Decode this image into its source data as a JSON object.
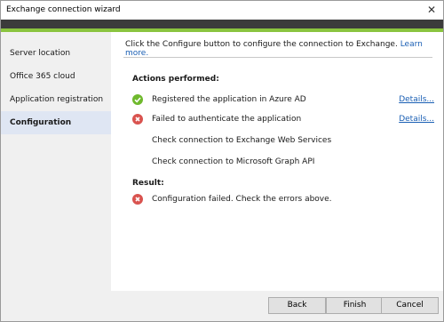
{
  "window": {
    "title": "Exchange connection wizard",
    "close_glyph": "✕"
  },
  "colors": {
    "accent": "#8ac43f",
    "header": "#3b3b3b",
    "link": "#1a5fb4",
    "success": "#6fb92d",
    "error": "#d9534f",
    "selected_nav": "#dfe6f3"
  },
  "sidebar": {
    "items": [
      {
        "label": "Server location"
      },
      {
        "label": "Office 365 cloud"
      },
      {
        "label": "Application registration"
      },
      {
        "label": "Configuration",
        "selected": true
      }
    ]
  },
  "main": {
    "intro_text": "Click the Configure button to configure the connection to Exchange.",
    "learn_more": "Learn more.",
    "actions_heading": "Actions performed:",
    "actions": [
      {
        "text": "Registered the application in Azure AD",
        "status": "success",
        "icon": "check-circle-icon",
        "details": "Details..."
      },
      {
        "text": "Failed to authenticate the application",
        "status": "error",
        "icon": "error-circle-icon",
        "details": "Details..."
      },
      {
        "text": "Check connection to Exchange Web Services",
        "status": "pending"
      },
      {
        "text": "Check connection to Microsoft Graph API",
        "status": "pending"
      }
    ],
    "result_heading": "Result:",
    "result": {
      "text": "Configuration failed. Check the errors above.",
      "status": "error",
      "icon": "error-circle-icon"
    }
  },
  "footer": {
    "back_label": "Back",
    "finish_label": "Finish",
    "cancel_label": "Cancel"
  }
}
